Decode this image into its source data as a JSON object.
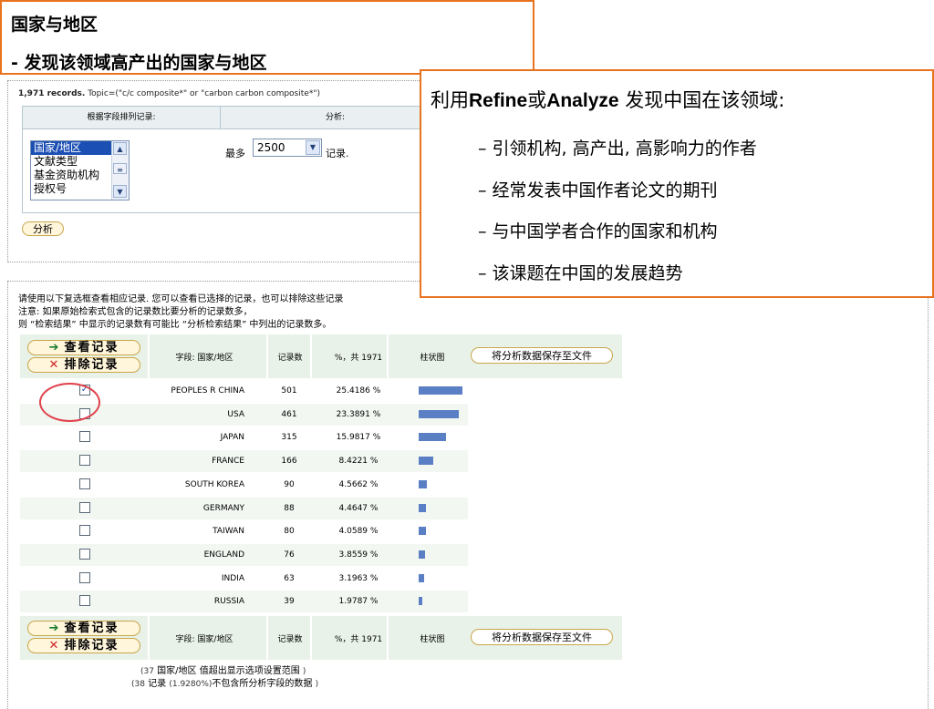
{
  "title": {
    "line1": "国家与地区",
    "line2": "- 发现该领域高产出的国家与地区"
  },
  "search": {
    "records_count": "1,971 records.",
    "topic": "Topic=(\"c/c composite*\" or \"carbon carbon composite*\")"
  },
  "upper_table": {
    "header_left": "根据字段排列记录:",
    "header_right": "分析:",
    "field_options": [
      "国家/地区",
      "文献类型",
      "基金资助机构",
      "授权号"
    ],
    "selected_field": "国家/地区",
    "max_label": "最多",
    "max_value": "2500",
    "records_suffix": "记录.",
    "analyze_button": "分析"
  },
  "callout": {
    "heading_pre": "利用",
    "heading_refine": "Refine",
    "heading_or": "或",
    "heading_analyze": "Analyze",
    "heading_post": " 发现中国在该领域:",
    "bullets": [
      "– 引领机构, 高产出, 高影响力的作者",
      "– 经常发表中国作者论文的期刊",
      "– 与中国学者合作的国家和机构",
      "– 该课题在中国的发展趋势"
    ]
  },
  "notes": {
    "line1": "请使用以下复选框查看相应记录. 您可以查看已选择的记录，也可以排除这些记录",
    "line2": "注意: 如果原始检索式包含的记录数比要分析的记录数多，",
    "line3": "则 “检索结果” 中显示的记录数有可能比 “分析检索结果” 中列出的记录数多。"
  },
  "table_header": {
    "view_records": "查看记录",
    "exclude_records": "排除记录",
    "field_label": "字段: 国家/地区",
    "count_label": "记录数",
    "pct_label": "%，共 1971",
    "bar_label": "柱状图",
    "save_button": "将分析数据保存至文件"
  },
  "rows": [
    {
      "country": "PEOPLES R CHINA",
      "count": "501",
      "pct": "25.4186 %",
      "checked": true,
      "share": 0.254186
    },
    {
      "country": "USA",
      "count": "461",
      "pct": "23.3891 %",
      "checked": false,
      "share": 0.233891
    },
    {
      "country": "JAPAN",
      "count": "315",
      "pct": "15.9817 %",
      "checked": false,
      "share": 0.159817
    },
    {
      "country": "FRANCE",
      "count": "166",
      "pct": "8.4221 %",
      "checked": false,
      "share": 0.084221
    },
    {
      "country": "SOUTH KOREA",
      "count": "90",
      "pct": "4.5662 %",
      "checked": false,
      "share": 0.045662
    },
    {
      "country": "GERMANY",
      "count": "88",
      "pct": "4.4647 %",
      "checked": false,
      "share": 0.044647
    },
    {
      "country": "TAIWAN",
      "count": "80",
      "pct": "4.0589 %",
      "checked": false,
      "share": 0.040589
    },
    {
      "country": "ENGLAND",
      "count": "76",
      "pct": "3.8559 %",
      "checked": false,
      "share": 0.038559
    },
    {
      "country": "INDIA",
      "count": "63",
      "pct": "3.1963 %",
      "checked": false,
      "share": 0.031963
    },
    {
      "country": "RUSSIA",
      "count": "39",
      "pct": "1.9787 %",
      "checked": false,
      "share": 0.019787
    }
  ],
  "footer": {
    "line1_count": "(37",
    "line1_text": "国家/地区 值超出显示选项设置范围",
    "line1_close": ")",
    "line2_count": "(38",
    "line2_text1": "记录",
    "line2_pct": "(1.9280%)",
    "line2_text2": "不包含所分析字段的数据",
    "line2_close": ")"
  },
  "colors": {
    "callout_border": "#e8731f",
    "bar": "#5b7fc4",
    "highlight_circle": "#e0424c",
    "selected_option": "#1c4fb4"
  }
}
